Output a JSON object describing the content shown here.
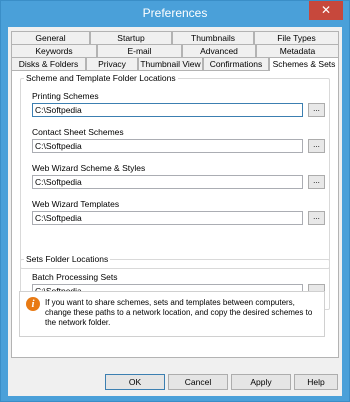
{
  "window": {
    "title": "Preferences",
    "close": "✕"
  },
  "tabs": {
    "row1": [
      "General",
      "Startup",
      "Thumbnails",
      "File Types"
    ],
    "row2": [
      "Keywords",
      "E-mail",
      "Advanced",
      "Metadata"
    ],
    "row3": [
      "Disks & Folders",
      "Privacy",
      "Thumbnail View",
      "Confirmations",
      "Schemes & Sets"
    ],
    "active": "Schemes & Sets"
  },
  "scheme_group": {
    "title": "Scheme and Template Folder Locations",
    "printing": {
      "label": "Printing Schemes",
      "value": "C:\\Softpedia"
    },
    "contact": {
      "label": "Contact Sheet Schemes",
      "value": "C:\\Softpedia"
    },
    "wizard_scheme": {
      "label": "Web Wizard Scheme & Styles",
      "value": "C:\\Softpedia"
    },
    "wizard_templates": {
      "label": "Web Wizard Templates",
      "value": "C:\\Softpedia"
    }
  },
  "sets_group": {
    "title": "Sets Folder Locations",
    "batch": {
      "label": "Batch Processing Sets",
      "value": "C:\\Softpedia"
    }
  },
  "browse_label": "...",
  "info": {
    "icon": "info-icon",
    "text": "If you want to share schemes, sets and templates between computers, change these paths to a network location, and copy the desired schemes to the network folder."
  },
  "buttons": {
    "ok": "OK",
    "cancel": "Cancel",
    "apply": "Apply",
    "help": "Help"
  }
}
